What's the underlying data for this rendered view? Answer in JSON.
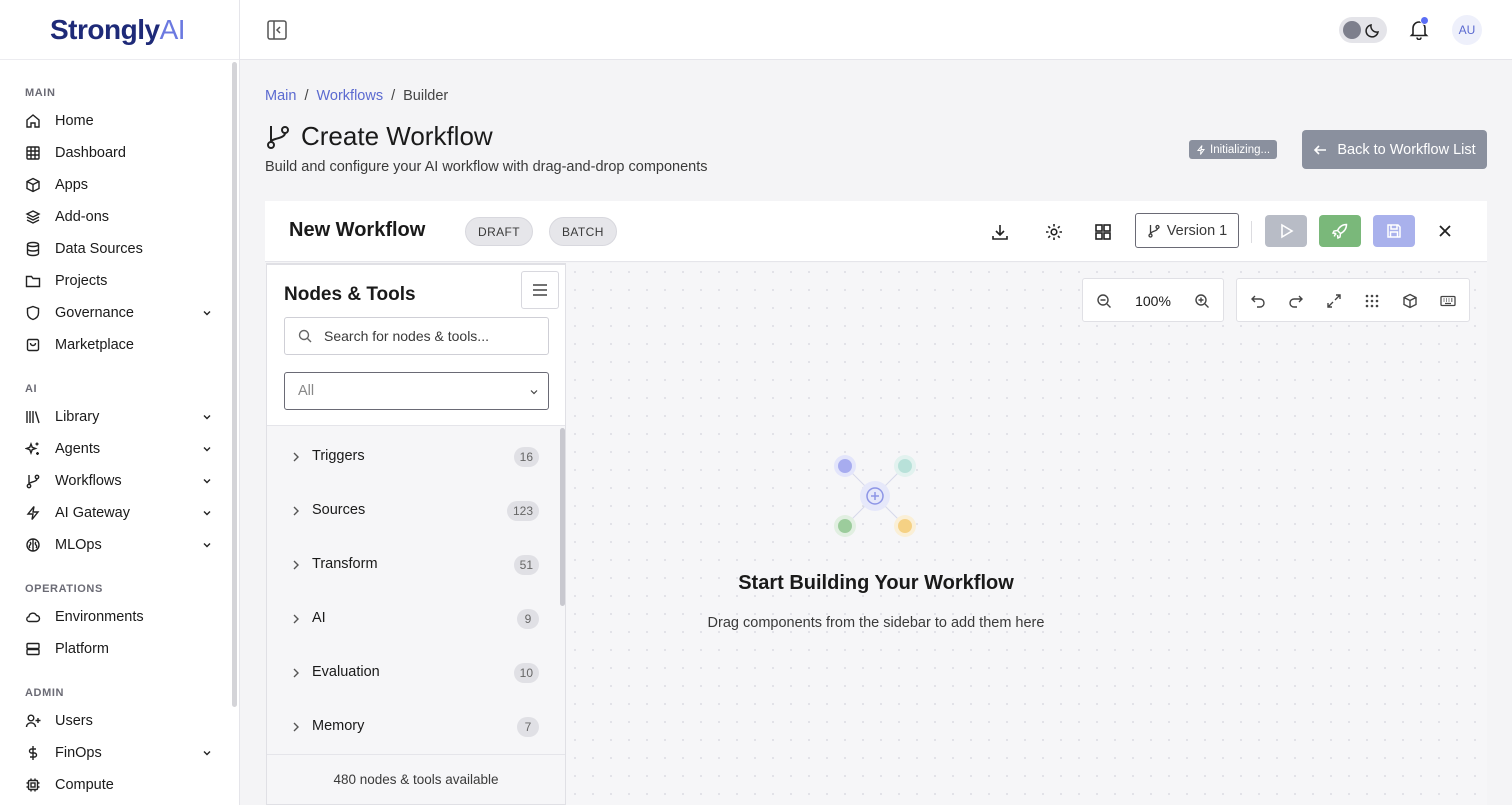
{
  "brand": {
    "name_main": "Strongly",
    "name_accent": "AI"
  },
  "sidebar": {
    "sections": [
      {
        "label": "MAIN"
      },
      {
        "label": "AI"
      },
      {
        "label": "OPERATIONS"
      },
      {
        "label": "ADMIN"
      }
    ],
    "items": [
      {
        "label": "Home",
        "icon": "home-icon"
      },
      {
        "label": "Dashboard",
        "icon": "grid-icon"
      },
      {
        "label": "Apps",
        "icon": "cube-icon"
      },
      {
        "label": "Add-ons",
        "icon": "layers-icon"
      },
      {
        "label": "Data Sources",
        "icon": "database-icon"
      },
      {
        "label": "Projects",
        "icon": "folder-icon"
      },
      {
        "label": "Governance",
        "icon": "shield-icon",
        "expandable": true
      },
      {
        "label": "Marketplace",
        "icon": "shopping-bag-icon"
      },
      {
        "label": "Library",
        "icon": "library-icon",
        "expandable": true
      },
      {
        "label": "Agents",
        "icon": "sparkles-icon",
        "expandable": true
      },
      {
        "label": "Workflows",
        "icon": "git-branch-icon",
        "expandable": true
      },
      {
        "label": "AI Gateway",
        "icon": "bolt-icon",
        "expandable": true
      },
      {
        "label": "MLOps",
        "icon": "brain-icon",
        "expandable": true
      },
      {
        "label": "Environments",
        "icon": "cloud-icon"
      },
      {
        "label": "Platform",
        "icon": "server-icon"
      },
      {
        "label": "Users",
        "icon": "user-plus-icon"
      },
      {
        "label": "FinOps",
        "icon": "dollar-icon",
        "expandable": true
      },
      {
        "label": "Compute",
        "icon": "cpu-icon"
      }
    ]
  },
  "header": {
    "avatar_initials": "AU",
    "notification_dot": true
  },
  "breadcrumb": {
    "items": [
      "Main",
      "Workflows",
      "Builder"
    ],
    "separator": "/"
  },
  "page": {
    "title": "Create Workflow",
    "subtitle": "Build and configure your AI workflow with drag-and-drop components",
    "status_badge": "Initializing...",
    "back_button": "Back to Workflow List"
  },
  "workflow": {
    "name": "New Workflow",
    "status_pill": "DRAFT",
    "mode_pill": "BATCH",
    "version_label": "Version 1"
  },
  "nodes_panel": {
    "title": "Nodes & Tools",
    "search_placeholder": "Search for nodes & tools...",
    "filter_value": "All",
    "categories": [
      {
        "label": "Triggers",
        "count": "16"
      },
      {
        "label": "Sources",
        "count": "123"
      },
      {
        "label": "Transform",
        "count": "51"
      },
      {
        "label": "AI",
        "count": "9"
      },
      {
        "label": "Evaluation",
        "count": "10"
      },
      {
        "label": "Memory",
        "count": "7"
      }
    ],
    "footer": "480 nodes & tools available"
  },
  "canvas": {
    "zoom": "100%",
    "empty_title": "Start Building Your Workflow",
    "empty_subtitle": "Drag components from the sidebar to add them here"
  },
  "colors": {
    "brand": "#1e2a78",
    "accent": "#6b79e0",
    "link": "#5b6ad0",
    "run_button": "#b8bcc6",
    "deploy_button": "#7ab87a",
    "save_button": "#a9b1ec",
    "badge_gray": "#8a909e"
  }
}
